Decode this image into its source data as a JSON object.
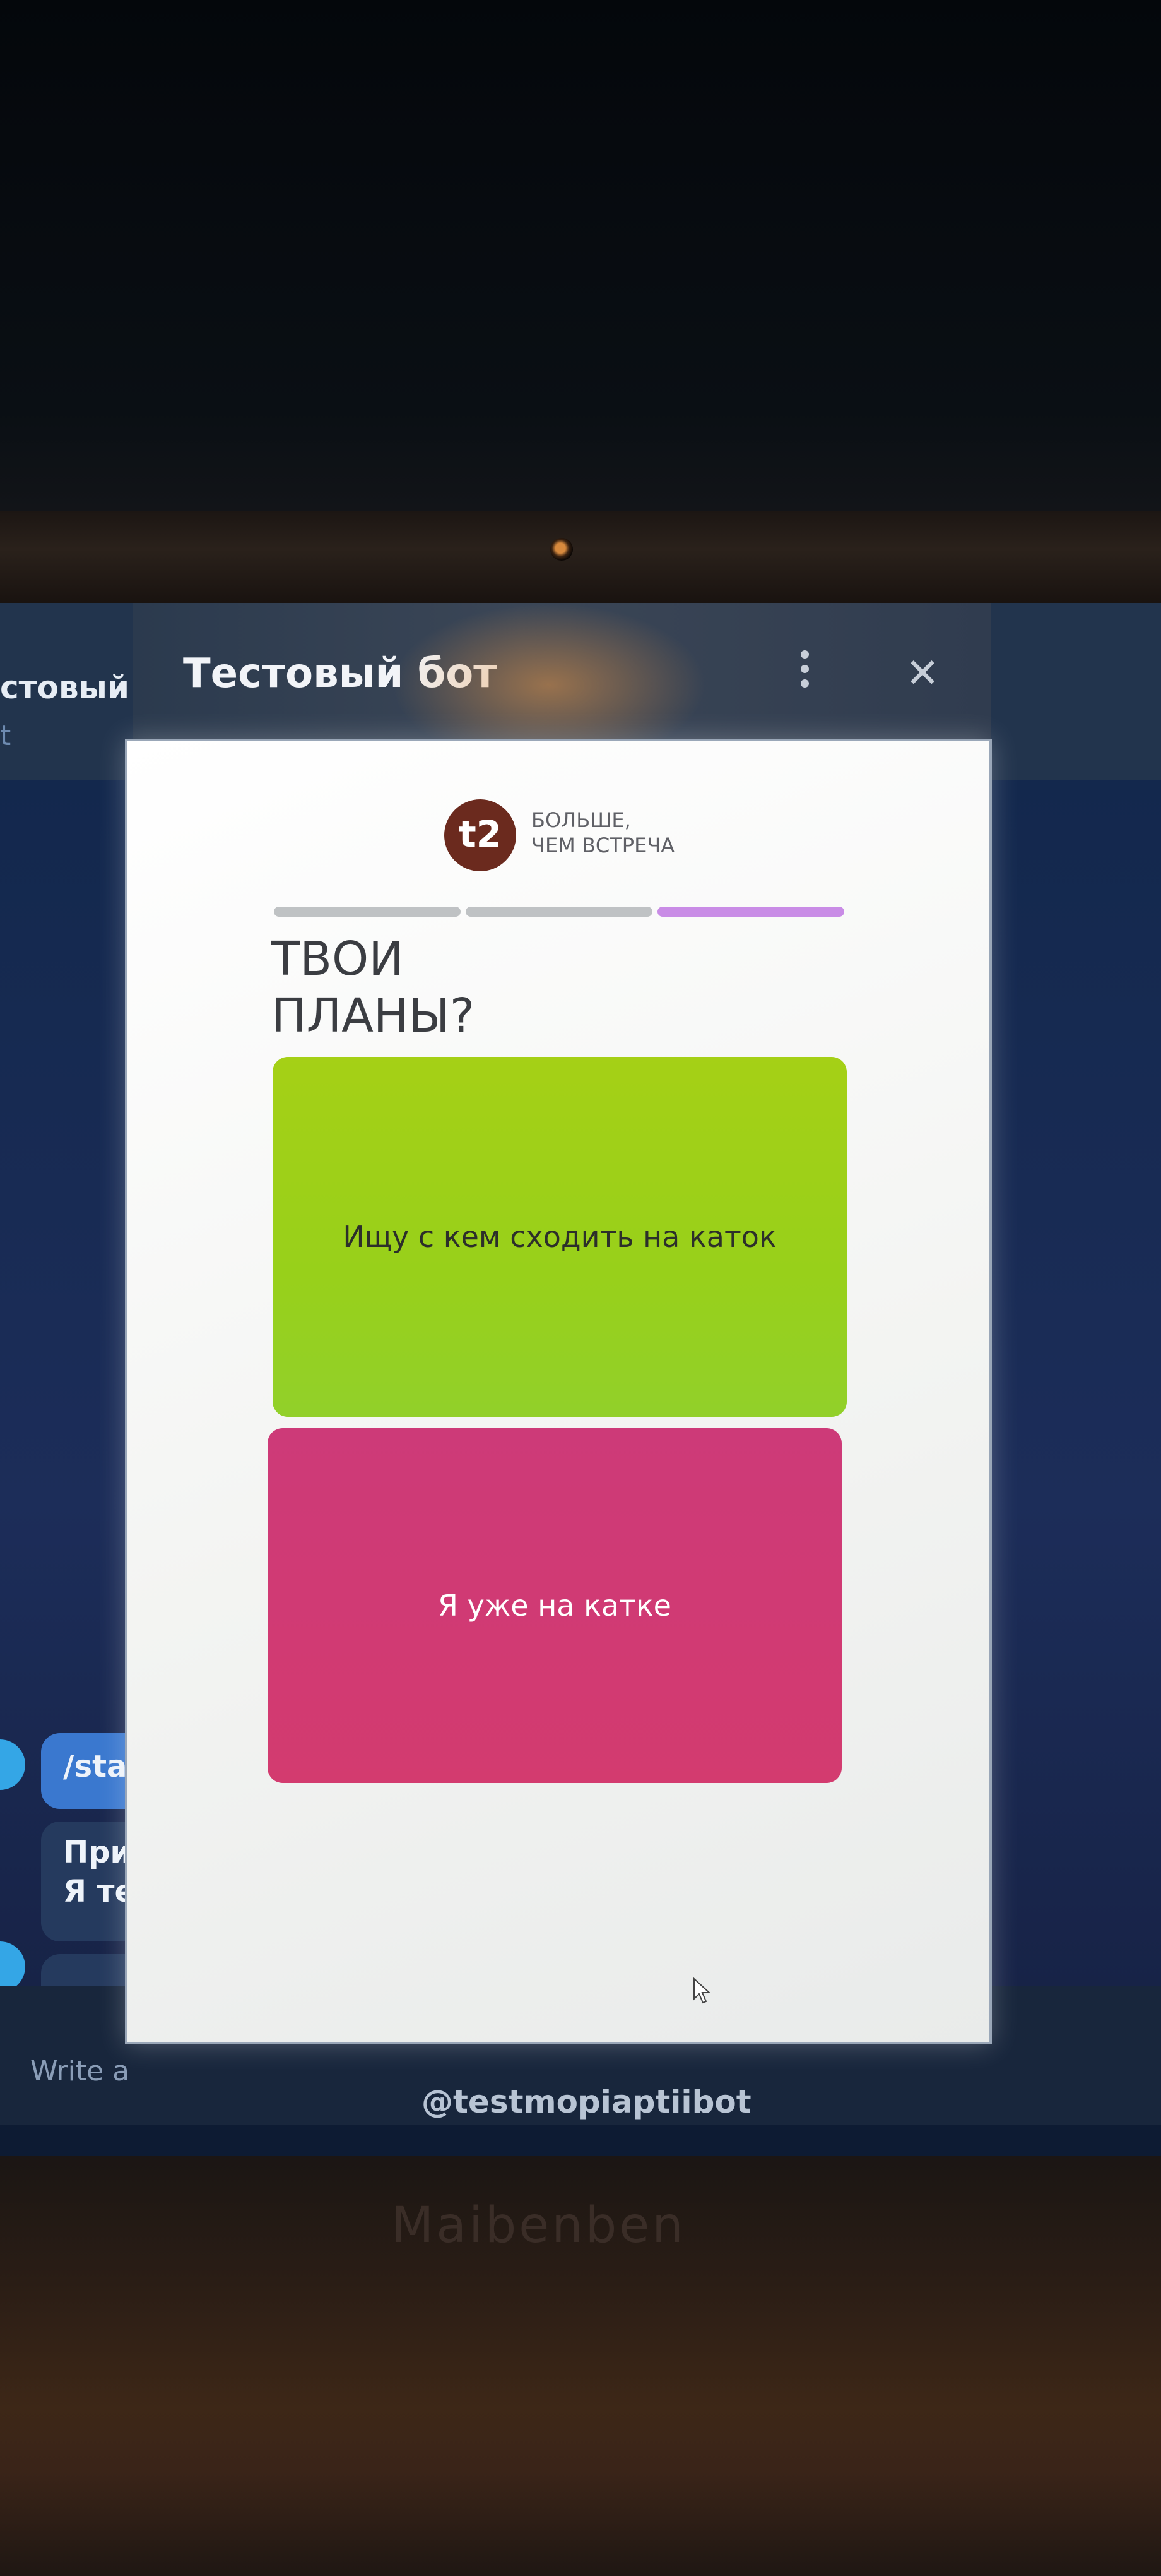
{
  "background_chat": {
    "title_fragment": "стовый бо",
    "subtitle_fragment": "t",
    "outgoing_message_fragment": "/star",
    "incoming_message_fragment_line1": "При",
    "incoming_message_fragment_line2": "Я тес",
    "input_placeholder_fragment": "Write a"
  },
  "dialog": {
    "title": "Тестовый бот",
    "bot_username": "@testmopiaptiibot"
  },
  "webapp": {
    "logo": {
      "mark": "t2",
      "text_line1": "БОЛЬШЕ,",
      "text_line2": "ЧЕМ ВСТРЕЧА"
    },
    "progress": {
      "total_steps": 3,
      "current_step": 3,
      "active_color": "#c98ce6"
    },
    "heading_line1": "ТВОИ",
    "heading_line2": "ПЛАНЫ?",
    "options": [
      {
        "label": "Ищу с кем сходить на каток",
        "color": "#a5d016"
      },
      {
        "label": "Я уже на катке",
        "color": "#d13a73"
      }
    ]
  },
  "laptop": {
    "brand": "Maibenben"
  },
  "icons": {
    "more": "more-vertical-icon",
    "close": "close-icon",
    "cursor": "mouse-cursor-icon"
  }
}
